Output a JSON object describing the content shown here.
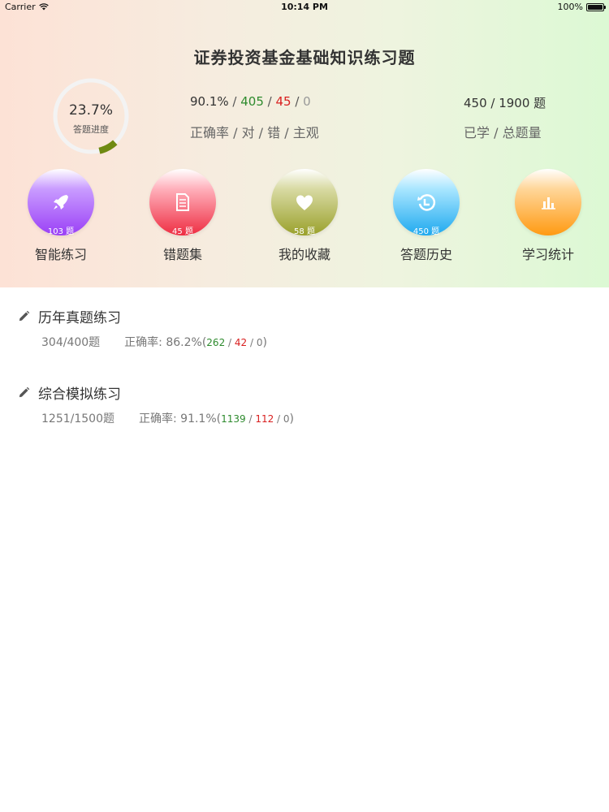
{
  "statusbar": {
    "carrier": "Carrier",
    "time": "10:14 PM",
    "battery": "100%"
  },
  "header": {
    "title": "证券投资基金基础知识练习题",
    "progress": {
      "percent_text": "23.7%",
      "caption": "答题进度",
      "value": 0.237
    },
    "accuracy": {
      "rate": "90.1%",
      "correct": "405",
      "wrong": "45",
      "subjective": "0",
      "slash": " / ",
      "label": "正确率 / 对 / 错 / 主观"
    },
    "learned": {
      "value": "450 / 1900 题",
      "label": "已学 / 总题量"
    }
  },
  "functions": [
    {
      "label": "智能练习",
      "count": "103 题",
      "icon": "rocket-icon"
    },
    {
      "label": "错题集",
      "count": "45 题",
      "icon": "document-icon"
    },
    {
      "label": "我的收藏",
      "count": "58 题",
      "icon": "heart-icon"
    },
    {
      "label": "答题历史",
      "count": "450 题",
      "icon": "history-icon"
    },
    {
      "label": "学习统计",
      "count": "",
      "icon": "bar-chart-icon"
    }
  ],
  "sections": [
    {
      "title": "历年真题练习",
      "progress": "304/400题",
      "accuracy_label": "正确率:",
      "rate": "86.2%",
      "open": "(",
      "correct": "262",
      "wrong": "42",
      "subjective": "0",
      "close": ")",
      "slash": " / "
    },
    {
      "title": "综合模拟练习",
      "progress": "1251/1500题",
      "accuracy_label": "正确率:",
      "rate": "91.1%",
      "open": "(",
      "correct": "1139",
      "wrong": "112",
      "subjective": "0",
      "close": ")",
      "slash": " / "
    }
  ],
  "colors": {
    "correct": "#2e8b2e",
    "wrong": "#d92020",
    "ring": "#6f8a12"
  }
}
